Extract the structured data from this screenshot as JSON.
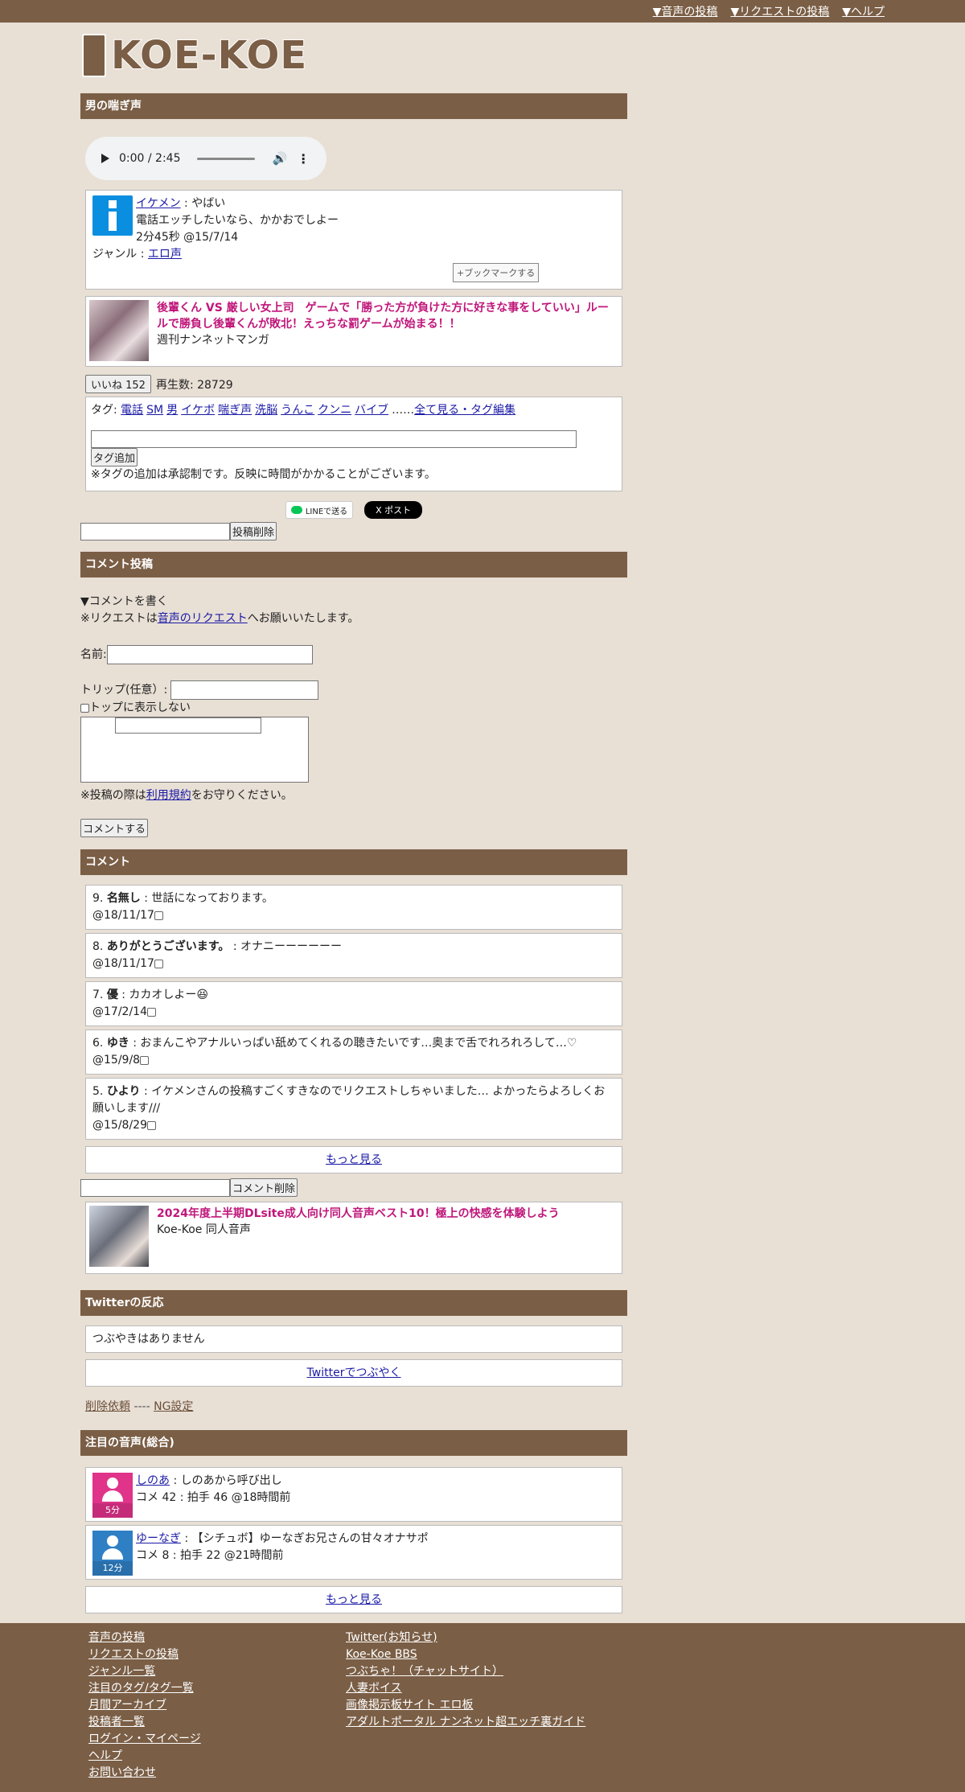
{
  "topnav": [
    "▼音声の投稿",
    "▼リクエストの投稿",
    "▼ヘルプ"
  ],
  "logo": "KOE-KOE",
  "voice": {
    "section_title": "男の喘ぎ声",
    "audio_time": "0:00 / 2:45",
    "poster": "イケメン",
    "title": "やばい",
    "description": "電話エッチしたいなら、かかおでしよー",
    "meta": "2分45秒 @15/7/14",
    "genre_label": "ジャンル : ",
    "genre": "エロ声",
    "bookmark": "+ブックマークする"
  },
  "ad1": {
    "title": "後輩くん VS 厳しい女上司　ゲームで「勝った方が負けた方に好きな事をしていい」ルールで勝負し後輩くんが敗北！えっちな罰ゲームが始まる！！",
    "source": "週刊ナンネットマンガ"
  },
  "like": {
    "button": "いいね 152",
    "plays": "再生数: 28729"
  },
  "tags": {
    "label": "タグ: ",
    "items": [
      "電話",
      "SM",
      "男",
      "イケボ",
      "喘ぎ声",
      "洗脳",
      "うんこ",
      "クンニ",
      "バイブ"
    ],
    "ellipsis": "……",
    "see_all": "全て見る・タグ編集",
    "add_button": "タグ追加",
    "note": "※タグの追加は承認制です。反映に時間がかかることがございます。"
  },
  "share": {
    "line": "LINEで送る",
    "x": "X ポスト"
  },
  "delete_post": "投稿削除",
  "comment_form": {
    "section_title": "コメント投稿",
    "write": "▼コメントを書く",
    "request_pre": "※リクエストは",
    "request_link": "音声のリクエスト",
    "request_post": "へお願いいたします。",
    "name_label": "名前:",
    "trip_label": "トリップ(任意）:",
    "hide_top": "トップに表示しない",
    "rules_pre": "※投稿の際は",
    "rules_link": "利用規約",
    "rules_post": "をお守りください。",
    "submit": "コメントする"
  },
  "comments": {
    "section_title": "コメント",
    "items": [
      {
        "num": "9.",
        "name": "名無し",
        "text": " : 世話になっております。",
        "date": "@18/11/17"
      },
      {
        "num": "8.",
        "name": "ありがとうございます。",
        "text": " : オナニーーーーーー",
        "date": "@18/11/17"
      },
      {
        "num": "7.",
        "name": "優",
        "text": " : カカオしよー😆",
        "date": "@17/2/14"
      },
      {
        "num": "6.",
        "name": "ゆき",
        "text": " : おまんこやアナルいっぱい舐めてくれるの聴きたいです…奥まで舌でれろれろして…♡",
        "date": "@15/9/8"
      },
      {
        "num": "5.",
        "name": "ひより",
        "text": " : イケメンさんの投稿すごくすきなのでリクエストしちゃいました… よかったらよろしくお願いします///",
        "date": "@15/8/29"
      }
    ],
    "more": "もっと見る",
    "delete": "コメント削除"
  },
  "ad2": {
    "title": "2024年度上半期DLsite成人向け同人音声ベスト10！極上の快感を体験しよう",
    "source": "Koe-Koe 同人音声"
  },
  "twitter": {
    "section_title": "Twitterの反応",
    "empty": "つぶやきはありません",
    "tweet": "Twitterでつぶやく"
  },
  "del_links": {
    "request": "削除依頼",
    "sep": " ---- ",
    "ng": "NG設定"
  },
  "attention": {
    "section_title": "注目の音声(総合)",
    "items": [
      {
        "user": "しのあ",
        "title": " : しのあから呼び出し",
        "meta": "コメ 42 : 拍手 46 @18時間前",
        "duration": "5分",
        "color": "#e0338a"
      },
      {
        "user": "ゆーなぎ",
        "title": " : 【シチュボ】ゆーなぎお兄さんの甘々オナサポ",
        "meta": "コメ 8 : 拍手 22 @21時間前",
        "duration": "12分",
        "color": "#2f7fc4"
      }
    ],
    "more": "もっと見る"
  },
  "footer": {
    "col1": [
      "音声の投稿",
      "リクエストの投稿",
      "ジャンル一覧",
      "注目のタグ/タグ一覧",
      "月間アーカイブ",
      "投稿者一覧",
      "ログイン・マイページ",
      "ヘルプ",
      "お問い合わせ"
    ],
    "col2": [
      "Twitter(お知らせ)",
      "Koe-Koe BBS",
      "つぶちゃ！（チャットサイト）",
      "人妻ボイス",
      "画像掲示板サイト エロ板",
      "アダルトポータル ナンネット超エッチ裏ガイド"
    ]
  }
}
